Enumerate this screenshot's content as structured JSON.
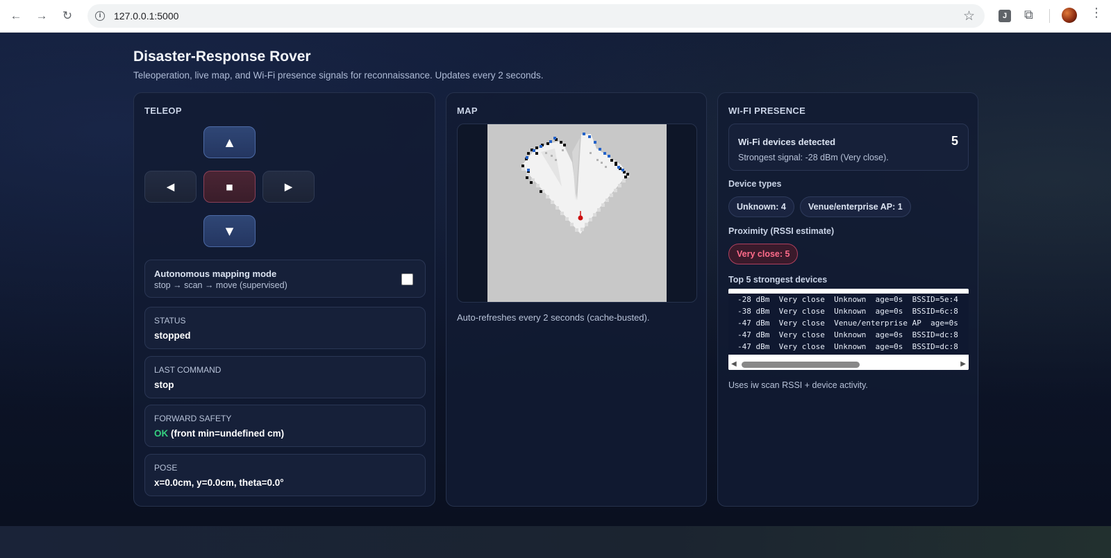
{
  "browser": {
    "url": "127.0.0.1:5000",
    "extension_label": "J"
  },
  "page": {
    "title": "Disaster-Response Rover",
    "subtitle": "Teleoperation, live map, and Wi-Fi presence signals for reconnaissance. Updates every 2 seconds."
  },
  "teleop": {
    "heading": "TELEOP",
    "buttons": {
      "up": "▲",
      "left": "◀",
      "stop": "■",
      "right": "▶",
      "down": "▼"
    },
    "autonomous": {
      "title": "Autonomous mapping mode",
      "subtitle": "stop → scan → move (supervised)",
      "checked": false
    },
    "status": {
      "label": "STATUS",
      "value": "stopped"
    },
    "last_command": {
      "label": "LAST COMMAND",
      "value": "stop"
    },
    "forward_safety": {
      "label": "FORWARD SAFETY",
      "ok": "OK",
      "detail": " (front min=undefined cm)",
      "ok_color": "#35d07f"
    },
    "pose": {
      "label": "POSE",
      "value": "x=0.0cm, y=0.0cm, theta=0.0°"
    }
  },
  "map": {
    "heading": "MAP",
    "caption": "Auto-refreshes every 2 seconds (cache-busted).",
    "colors": {
      "unknown": "#c8c8c8",
      "free": "#f2f2f2",
      "occupied": "#111111",
      "marker": "#2563c9",
      "robot": "#cc1111"
    }
  },
  "wifi": {
    "heading": "WI-FI PRESENCE",
    "detected_label": "Wi-Fi devices detected",
    "detected_count": "5",
    "strongest": "Strongest signal: -28 dBm (Very close).",
    "types_heading": "Device types",
    "types": [
      "Unknown: 4",
      "Venue/enterprise AP: 1"
    ],
    "proximity_heading": "Proximity (RSSI estimate)",
    "proximity": [
      "Very close: 5"
    ],
    "top_heading": "Top 5 strongest devices",
    "devices": [
      "-28 dBm  Very close  Unknown  age=0s  BSSID=5e:4",
      "-38 dBm  Very close  Unknown  age=0s  BSSID=6c:8",
      "-47 dBm  Very close  Venue/enterprise AP  age=0s",
      "-47 dBm  Very close  Unknown  age=0s  BSSID=dc:8",
      "-47 dBm  Very close  Unknown  age=0s  BSSID=dc:8"
    ],
    "note": "Uses iw scan RSSI + device activity.",
    "close_color": "#ff6b8a"
  }
}
